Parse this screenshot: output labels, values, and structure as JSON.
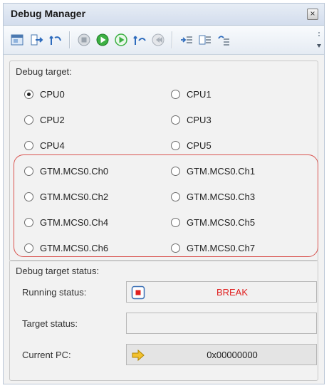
{
  "window": {
    "title": "Debug Manager"
  },
  "toolbar": {
    "buttons": [
      "panel-icon",
      "step-in-icon",
      "step-back-icon",
      "stop-icon",
      "go-icon",
      "run-icon",
      "step-over-icon",
      "return-icon",
      "list-a-icon",
      "list-b-icon",
      "list-c-icon"
    ]
  },
  "debug_target": {
    "title": "Debug target:",
    "options": [
      {
        "label": "CPU0",
        "checked": true
      },
      {
        "label": "CPU1",
        "checked": false
      },
      {
        "label": "CPU2",
        "checked": false
      },
      {
        "label": "CPU3",
        "checked": false
      },
      {
        "label": "CPU4",
        "checked": false
      },
      {
        "label": "CPU5",
        "checked": false
      },
      {
        "label": "GTM.MCS0.Ch0",
        "checked": false
      },
      {
        "label": "GTM.MCS0.Ch1",
        "checked": false
      },
      {
        "label": "GTM.MCS0.Ch2",
        "checked": false
      },
      {
        "label": "GTM.MCS0.Ch3",
        "checked": false
      },
      {
        "label": "GTM.MCS0.Ch4",
        "checked": false
      },
      {
        "label": "GTM.MCS0.Ch5",
        "checked": false
      },
      {
        "label": "GTM.MCS0.Ch6",
        "checked": false
      },
      {
        "label": "GTM.MCS0.Ch7",
        "checked": false
      }
    ]
  },
  "status": {
    "title": "Debug target status:",
    "running_label": "Running status:",
    "running_value": "BREAK",
    "running_color": "#e02020",
    "target_label": "Target status:",
    "target_value": "",
    "pc_label": "Current PC:",
    "pc_value": "0x00000000"
  },
  "colors": {
    "highlight": "#d9534f",
    "go_green": "#2fa62f"
  }
}
